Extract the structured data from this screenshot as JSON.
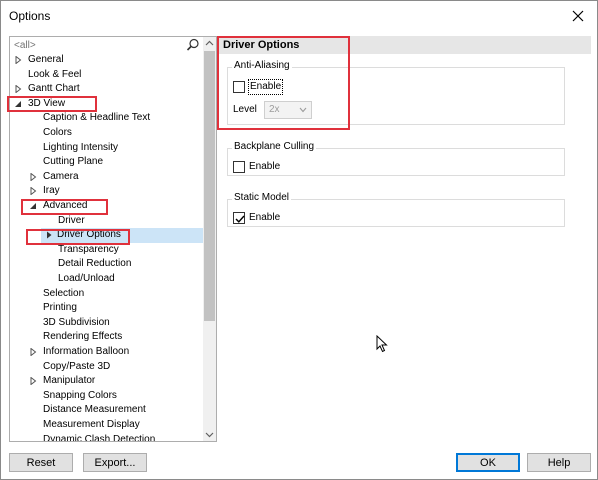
{
  "window": {
    "title": "Options"
  },
  "search": {
    "placeholder": "<all>"
  },
  "tree": [
    {
      "label": "General",
      "expander": "collapsed"
    },
    {
      "label": "Look & Feel",
      "expander": "none"
    },
    {
      "label": "Gantt Chart",
      "expander": "collapsed"
    },
    {
      "label": "3D View",
      "expander": "expanded"
    },
    {
      "label": "Caption & Headline Text",
      "expander": "none"
    },
    {
      "label": "Colors",
      "expander": "none"
    },
    {
      "label": "Lighting Intensity",
      "expander": "none"
    },
    {
      "label": "Cutting Plane",
      "expander": "none"
    },
    {
      "label": "Camera",
      "expander": "collapsed"
    },
    {
      "label": "Iray",
      "expander": "collapsed"
    },
    {
      "label": "Advanced",
      "expander": "expanded"
    },
    {
      "label": "Driver",
      "expander": "none"
    },
    {
      "label": "Driver Options",
      "expander": "collapsed-dark",
      "selected": true
    },
    {
      "label": "Transparency",
      "expander": "none"
    },
    {
      "label": "Detail Reduction",
      "expander": "none"
    },
    {
      "label": "Load/Unload",
      "expander": "none"
    },
    {
      "label": "Selection",
      "expander": "none"
    },
    {
      "label": "Printing",
      "expander": "none"
    },
    {
      "label": "3D Subdivision",
      "expander": "none"
    },
    {
      "label": "Rendering Effects",
      "expander": "none"
    },
    {
      "label": "Information Balloon",
      "expander": "collapsed"
    },
    {
      "label": "Copy/Paste 3D",
      "expander": "none"
    },
    {
      "label": "Manipulator",
      "expander": "collapsed"
    },
    {
      "label": "Snapping Colors",
      "expander": "none"
    },
    {
      "label": "Distance Measurement",
      "expander": "none"
    },
    {
      "label": "Measurement Display",
      "expander": "none"
    },
    {
      "label": "Dynamic Clash Detection",
      "expander": "none"
    }
  ],
  "panel": {
    "header": "Driver Options",
    "anti_aliasing": {
      "title": "Anti-Aliasing",
      "enable_label": "Enable",
      "enable_checked": false,
      "level_label": "Level",
      "level_value": "2x"
    },
    "backplane_culling": {
      "title": "Backplane Culling",
      "enable_label": "Enable",
      "enable_checked": false
    },
    "static_model": {
      "title": "Static Model",
      "enable_label": "Enable",
      "enable_checked": true
    }
  },
  "buttons": {
    "reset": "Reset",
    "export": "Export...",
    "ok": "OK",
    "help": "Help"
  },
  "colors": {
    "annotation": "#e0313c",
    "selection": "#cce4f7",
    "header_bg": "#e6e6e6"
  }
}
